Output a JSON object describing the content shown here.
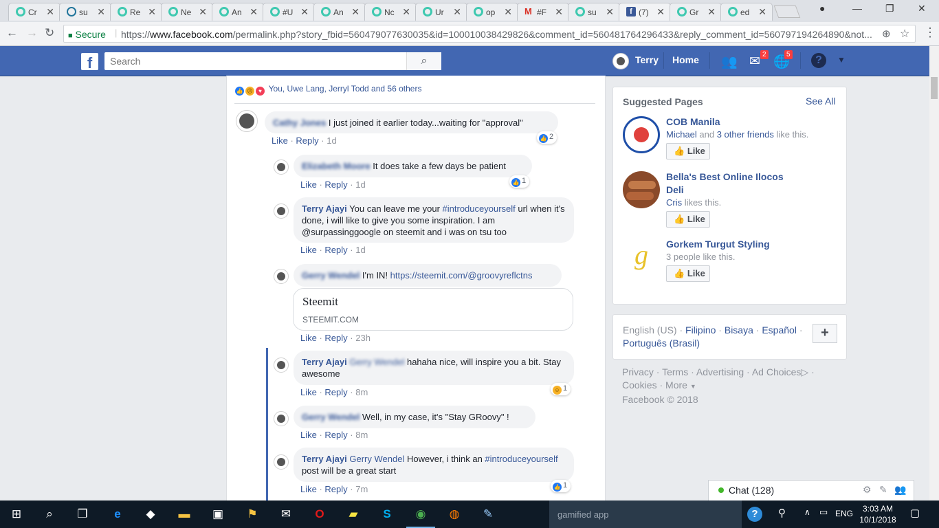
{
  "browser": {
    "tabs": [
      {
        "label": "Cr",
        "icon": "steem-icon"
      },
      {
        "label": "su",
        "icon": "wordpress-icon"
      },
      {
        "label": "Re",
        "icon": "steem-icon"
      },
      {
        "label": "Ne",
        "icon": "steem-icon"
      },
      {
        "label": "An",
        "icon": "steem-icon"
      },
      {
        "label": "#U",
        "icon": "steem-icon"
      },
      {
        "label": "An",
        "icon": "steem-icon"
      },
      {
        "label": "Nc",
        "icon": "steem-icon"
      },
      {
        "label": "Ur",
        "icon": "steem-icon"
      },
      {
        "label": "op",
        "icon": "steem-icon"
      },
      {
        "label": "#F",
        "icon": "gmail-icon"
      },
      {
        "label": "su",
        "icon": "steem-icon"
      },
      {
        "label": "(7)",
        "icon": "facebook-icon"
      },
      {
        "label": "Gr",
        "icon": "steem-icon"
      },
      {
        "label": "ed",
        "icon": "steem-icon"
      }
    ],
    "secure_label": "Secure",
    "url_scheme": "https://",
    "url_host": "www.facebook.com",
    "url_rest": "/permalink.php?story_fbid=560479077630035&id=100010038429826&comment_id=560481764296433&reply_comment_id=560797194264890&not..."
  },
  "fb_header": {
    "search_placeholder": "Search",
    "user_name": "Terry",
    "home_label": "Home",
    "messages_badge": "2",
    "notifications_badge": "5"
  },
  "post": {
    "reactions_text": "You, Uwe Lang, Jerryl Todd and 56 others"
  },
  "comments": [
    {
      "name": "Cathy Jones",
      "text": " I just joined it earlier today...waiting for \"approval\"",
      "like": "Like",
      "reply": "Reply",
      "time": "1d",
      "count": "2"
    },
    {
      "name": "Elizabeth Moore",
      "text": " It does take a few days be patient",
      "like": "Like",
      "reply": "Reply",
      "time": "1d",
      "count": "1"
    },
    {
      "name": "Terry Ajayi",
      "text": " You can leave me your ",
      "tag": "#introduceyourself",
      "text2": " url when it's done, i will like to give you some inspiration. I am @surpassinggoogle on steemit and i was on tsu too",
      "like": "Like",
      "reply": "Reply",
      "time": "1d"
    },
    {
      "name": "Gerry Wendel",
      "text": " I'm IN! ",
      "link": "https://steemit.com/@groovyreflctns",
      "like": "Like",
      "reply": "Reply",
      "time": "23h",
      "preview_title": "Steemit",
      "preview_domain": "STEEMIT.COM"
    },
    {
      "name": "Terry Ajayi",
      "mention": "Gerry Wendel",
      "text": " hahaha nice, will inspire you a bit. Stay awesome",
      "like": "Like",
      "reply": "Reply",
      "time": "8m",
      "count": "1"
    },
    {
      "name": "Gerry Wendel",
      "text": " Well, in my case, it's \"Stay GRoovy\" !",
      "like": "Like",
      "reply": "Reply",
      "time": "8m"
    },
    {
      "name": "Terry Ajayi",
      "mention": "Gerry Wendel",
      "text": " However, i think an ",
      "tag": "#introduceyourself",
      "text2": " post will be a great start",
      "like": "Like",
      "reply": "Reply",
      "time": "7m",
      "count": "1"
    }
  ],
  "suggested": {
    "title": "Suggested Pages",
    "see_all": "See All",
    "pages": [
      {
        "name": "COB Manila",
        "friend": "Michael",
        "mid": " and ",
        "others": "3 other friends",
        "tail": " like this.",
        "button": "Like"
      },
      {
        "name": "Bella's Best Online Ilocos Deli",
        "friend": "Cris",
        "tail": " likes this.",
        "button": "Like"
      },
      {
        "name": "Gorkem Turgut Styling",
        "tail": "3 people like this.",
        "button": "Like"
      }
    ]
  },
  "languages": {
    "current": "English (US)",
    "others": [
      "Filipino",
      "Bisaya",
      "Español",
      "Português (Brasil)"
    ],
    "add_label": "+"
  },
  "footer": {
    "links": [
      "Privacy",
      "Terms",
      "Advertising",
      "Ad Choices",
      "Cookies",
      "More"
    ],
    "copyright": "Facebook © 2018"
  },
  "chat": {
    "label": "Chat (128)"
  },
  "taskbar": {
    "note": "gamified app",
    "lang": "ENG",
    "time": "3:03 AM",
    "date": "10/1/2018"
  }
}
